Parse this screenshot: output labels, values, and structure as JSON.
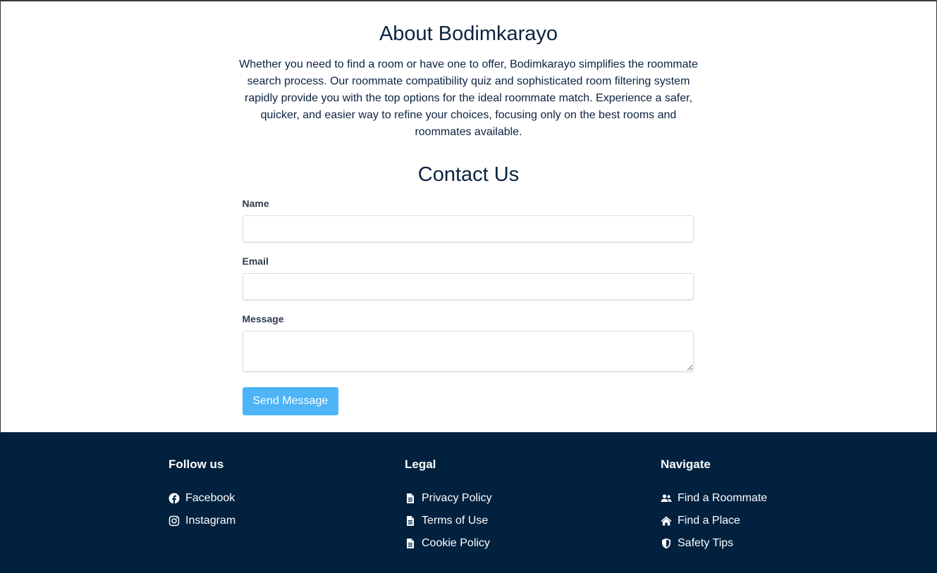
{
  "about": {
    "title": "About Bodimkarayo",
    "text": "Whether you need to find a room or have one to offer, Bodimkarayo simplifies the roommate search process. Our roommate compatibility quiz and sophisticated room filtering system rapidly provide you with the top options for the ideal roommate match. Experience a safer, quicker, and easier way to refine your choices, focusing only on the best rooms and roommates available."
  },
  "contact": {
    "title": "Contact Us",
    "name_label": "Name",
    "name_value": "",
    "email_label": "Email",
    "email_value": "",
    "message_label": "Message",
    "message_value": "",
    "send_label": "Send Message",
    "button_color": "#4db4f7"
  },
  "footer": {
    "background": "#01213f",
    "follow": {
      "heading": "Follow us",
      "links": [
        {
          "label": "Facebook",
          "icon": "facebook-icon"
        },
        {
          "label": "Instagram",
          "icon": "instagram-icon"
        }
      ]
    },
    "legal": {
      "heading": "Legal",
      "links": [
        {
          "label": "Privacy Policy",
          "icon": "document-icon"
        },
        {
          "label": "Terms of Use",
          "icon": "document-icon"
        },
        {
          "label": "Cookie Policy",
          "icon": "document-icon"
        }
      ]
    },
    "navigate": {
      "heading": "Navigate",
      "links": [
        {
          "label": "Find a Roommate",
          "icon": "users-icon"
        },
        {
          "label": "Find a Place",
          "icon": "home-icon"
        },
        {
          "label": "Safety Tips",
          "icon": "shield-icon"
        }
      ]
    }
  }
}
